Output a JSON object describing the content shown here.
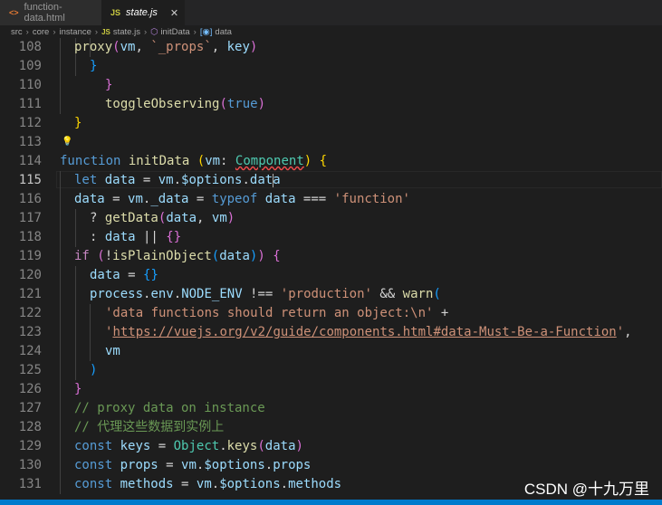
{
  "tabs": [
    {
      "label": "function-data.html",
      "icon": "<>",
      "active": false
    },
    {
      "label": "state.js",
      "icon": "JS",
      "active": true,
      "close": "✕"
    }
  ],
  "breadcrumb": {
    "parts": [
      "src",
      "core",
      "instance"
    ],
    "file_icon": "JS",
    "file": "state.js",
    "fn_icon": "⬡",
    "fn": "initData",
    "var_icon": "[◉]",
    "var": "data"
  },
  "colors": {
    "keyword": "#569cd6",
    "control": "#c586c0",
    "function": "#dcdcaa",
    "variable": "#9cdcfe",
    "string": "#ce9178",
    "comment": "#6a9955",
    "type": "#4ec9b0",
    "bracket_gold": "#ffd700",
    "bracket_purple": "#da70d6",
    "bracket_blue": "#179fff"
  },
  "lines": [
    {
      "n": "108",
      "tokens": [
        [
          "proxy",
          "fn"
        ],
        [
          "(",
          "b2"
        ],
        [
          "vm",
          "v"
        ],
        [
          ", ",
          "p"
        ],
        [
          "`_props`",
          "s"
        ],
        [
          ", ",
          "p"
        ],
        [
          "key",
          "v"
        ],
        [
          ")",
          "b2"
        ]
      ]
    },
    {
      "n": "109",
      "tokens": [
        [
          "}",
          "b3"
        ]
      ]
    },
    {
      "n": "110",
      "tokens": [
        [
          "}",
          "b2"
        ]
      ]
    },
    {
      "n": "111",
      "tokens": [
        [
          "toggleObserving",
          "fn"
        ],
        [
          "(",
          "b2"
        ],
        [
          "true",
          "k"
        ],
        [
          ")",
          "b2"
        ]
      ]
    },
    {
      "n": "112",
      "tokens": [
        [
          "}",
          "b1"
        ]
      ]
    },
    {
      "n": "113",
      "tokens": []
    },
    {
      "n": "114",
      "tokens": [
        [
          "function",
          "k"
        ],
        [
          " ",
          "p"
        ],
        [
          "initData",
          "fn"
        ],
        [
          " ",
          "p"
        ],
        [
          "(",
          "b1"
        ],
        [
          "vm",
          "v"
        ],
        [
          ": ",
          "p"
        ],
        [
          "Component",
          "t"
        ],
        [
          ") ",
          "b1"
        ],
        [
          "{",
          "b1"
        ]
      ]
    },
    {
      "n": "115",
      "tokens": [
        [
          "let",
          "k"
        ],
        [
          " ",
          "p"
        ],
        [
          "data",
          "v"
        ],
        [
          " = ",
          "p"
        ],
        [
          "vm",
          "v"
        ],
        [
          ".",
          "p"
        ],
        [
          "$options",
          "v"
        ],
        [
          ".",
          "p"
        ],
        [
          "data",
          "v"
        ]
      ]
    },
    {
      "n": "116",
      "tokens": [
        [
          "data",
          "v"
        ],
        [
          " = ",
          "p"
        ],
        [
          "vm",
          "v"
        ],
        [
          ".",
          "p"
        ],
        [
          "_data",
          "v"
        ],
        [
          " = ",
          "p"
        ],
        [
          "typeof",
          "k"
        ],
        [
          " ",
          "p"
        ],
        [
          "data",
          "v"
        ],
        [
          " === ",
          "p"
        ],
        [
          "'function'",
          "s"
        ]
      ]
    },
    {
      "n": "117",
      "tokens": [
        [
          "? ",
          "p"
        ],
        [
          "getData",
          "fn"
        ],
        [
          "(",
          "b2"
        ],
        [
          "data",
          "v"
        ],
        [
          ", ",
          "p"
        ],
        [
          "vm",
          "v"
        ],
        [
          ")",
          "b2"
        ]
      ]
    },
    {
      "n": "118",
      "tokens": [
        [
          ": ",
          "p"
        ],
        [
          "data",
          "v"
        ],
        [
          " || ",
          "p"
        ],
        [
          "{}",
          "b2"
        ]
      ]
    },
    {
      "n": "119",
      "tokens": [
        [
          "if",
          "c"
        ],
        [
          " ",
          "p"
        ],
        [
          "(",
          "b2"
        ],
        [
          "!",
          "p"
        ],
        [
          "isPlainObject",
          "fn"
        ],
        [
          "(",
          "b3"
        ],
        [
          "data",
          "v"
        ],
        [
          ")",
          "b3"
        ],
        [
          ")",
          "b2"
        ],
        [
          " ",
          "p"
        ],
        [
          "{",
          "b2"
        ]
      ]
    },
    {
      "n": "120",
      "tokens": [
        [
          "data",
          "v"
        ],
        [
          " = ",
          "p"
        ],
        [
          "{}",
          "b3"
        ]
      ]
    },
    {
      "n": "121",
      "tokens": [
        [
          "process",
          "v"
        ],
        [
          ".",
          "p"
        ],
        [
          "env",
          "v"
        ],
        [
          ".",
          "p"
        ],
        [
          "NODE_ENV",
          "v"
        ],
        [
          " !== ",
          "p"
        ],
        [
          "'production'",
          "s"
        ],
        [
          " && ",
          "p"
        ],
        [
          "warn",
          "fn"
        ],
        [
          "(",
          "b3"
        ]
      ]
    },
    {
      "n": "122",
      "tokens": [
        [
          "'data functions should return an object:\\n'",
          "s"
        ],
        [
          " +",
          "p"
        ]
      ]
    },
    {
      "n": "123",
      "tokens": [
        [
          "'",
          "s"
        ],
        [
          "https://vuejs.org/v2/guide/components.html#data-Must-Be-a-Function",
          "su"
        ],
        [
          "'",
          "s"
        ],
        [
          ",",
          "p"
        ]
      ]
    },
    {
      "n": "124",
      "tokens": [
        [
          "vm",
          "v"
        ]
      ]
    },
    {
      "n": "125",
      "tokens": [
        [
          ")",
          "b3"
        ]
      ]
    },
    {
      "n": "126",
      "tokens": [
        [
          "}",
          "b2"
        ]
      ]
    },
    {
      "n": "127",
      "tokens": [
        [
          "// proxy data on instance",
          "cm"
        ]
      ]
    },
    {
      "n": "128",
      "tokens": [
        [
          "// 代理这些数据到实例上",
          "cm"
        ]
      ]
    },
    {
      "n": "129",
      "tokens": [
        [
          "const",
          "k"
        ],
        [
          " ",
          "p"
        ],
        [
          "keys",
          "v"
        ],
        [
          " = ",
          "p"
        ],
        [
          "Object",
          "t"
        ],
        [
          ".",
          "p"
        ],
        [
          "keys",
          "fn"
        ],
        [
          "(",
          "b2"
        ],
        [
          "data",
          "v"
        ],
        [
          ")",
          "b2"
        ]
      ]
    },
    {
      "n": "130",
      "tokens": [
        [
          "const",
          "k"
        ],
        [
          " ",
          "p"
        ],
        [
          "props",
          "v"
        ],
        [
          " = ",
          "p"
        ],
        [
          "vm",
          "v"
        ],
        [
          ".",
          "p"
        ],
        [
          "$options",
          "v"
        ],
        [
          ".",
          "p"
        ],
        [
          "props",
          "v"
        ]
      ]
    },
    {
      "n": "131",
      "tokens": [
        [
          "const",
          "k"
        ],
        [
          " ",
          "p"
        ],
        [
          "methods",
          "v"
        ],
        [
          " = ",
          "p"
        ],
        [
          "vm",
          "v"
        ],
        [
          ".",
          "p"
        ],
        [
          "$options",
          "v"
        ],
        [
          ".",
          "p"
        ],
        [
          "methods",
          "v"
        ]
      ]
    }
  ],
  "watermark": "CSDN @十九万里"
}
